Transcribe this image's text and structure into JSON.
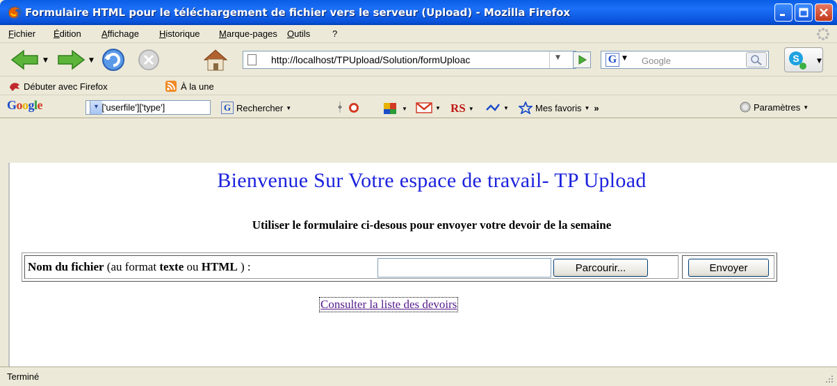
{
  "window": {
    "title": "Formulaire HTML pour le téléchargement de fichier vers le serveur (Upload) - Mozilla Firefox"
  },
  "menu": {
    "items": [
      "Fichier",
      "Édition",
      "Affichage",
      "Historique",
      "Marque-pages",
      "Outils",
      "?"
    ]
  },
  "navbar": {
    "url": "http://localhost/TPUpload/Solution/formUploac",
    "search_placeholder": "Google",
    "icons": [
      "back-arrow-icon",
      "forward-arrow-icon",
      "reload-icon",
      "stop-icon",
      "home-icon",
      "go-arrow-icon",
      "magnifier-icon",
      "skype-icon"
    ]
  },
  "bookmarks": {
    "items": [
      "Débuter avec Firefox",
      "À la une"
    ]
  },
  "google_toolbar": {
    "logo": "Google",
    "query": "ES['userfile']['type']",
    "search_label": "Rechercher",
    "favorites_label": "Mes favoris",
    "more_label": "»",
    "settings_label": "Paramètres",
    "rs_label": "RS"
  },
  "page": {
    "heading": "Bienvenue Sur Votre espace de travail- TP Upload",
    "subtitle": "Utiliser le formulaire ci-desous pour envoyer votre devoir de la semaine",
    "form": {
      "label_bold_1": "Nom du fichier",
      "label_mid_1": " (au format ",
      "label_bold_2": "texte",
      "label_mid_2": " ou ",
      "label_bold_3": "HTML",
      "label_end": " ) :",
      "file_value": "",
      "browse_button": "Parcourir...",
      "send_button": "Envoyer"
    },
    "link": "Consulter la liste des devoirs"
  },
  "status": {
    "text": "Terminé"
  },
  "colors": {
    "titlebar": "#0a5ee5",
    "heading": "#1c22dd",
    "visited_link": "#551a8b"
  }
}
